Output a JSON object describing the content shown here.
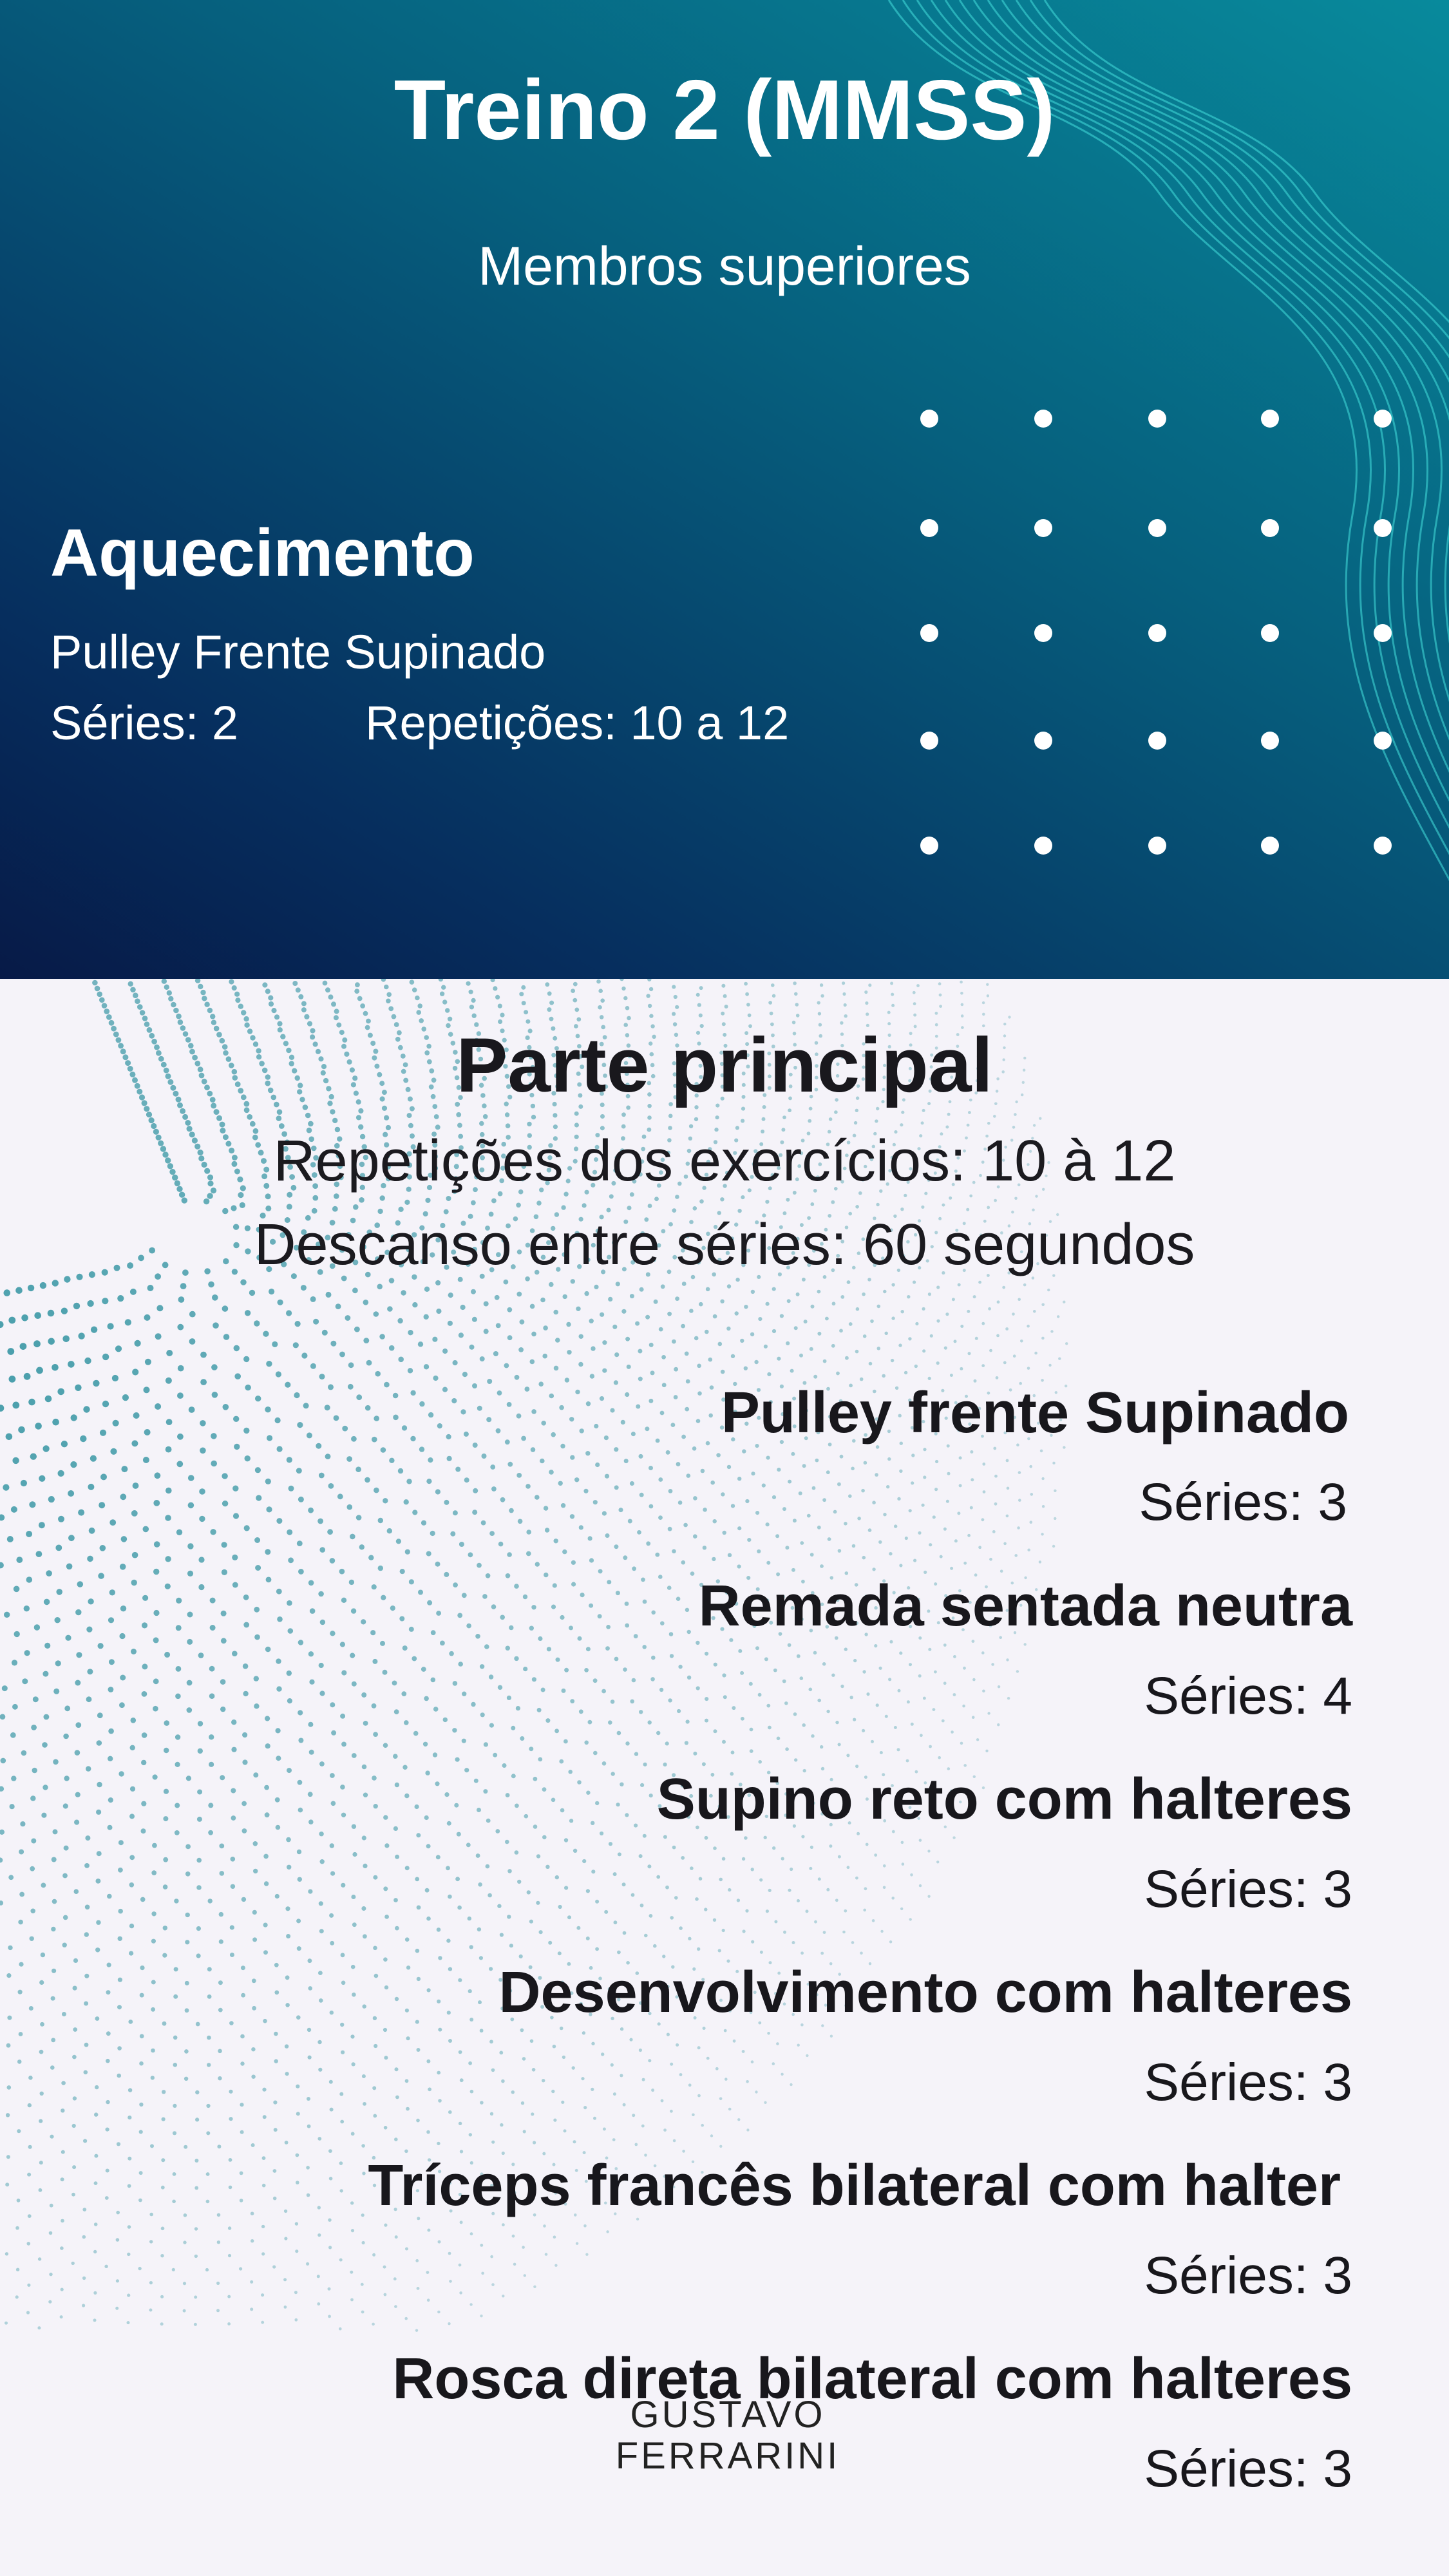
{
  "header": {
    "title": "Treino 2 (MMSS)",
    "subtitle": "Membros superiores"
  },
  "warmup": {
    "heading": "Aquecimento",
    "exercise": "Pulley Frente Supinado",
    "series": "Séries: 2",
    "reps": "Repetições: 10 a 12"
  },
  "main": {
    "heading": "Parte principal",
    "reps_info": "Repetições dos exercícios: 10 à 12",
    "rest_info": "Descanso entre séries: 60 segundos",
    "exercises": [
      {
        "name": "Pulley frente Supinado",
        "series": "Séries: 3"
      },
      {
        "name": "Remada sentada neutra",
        "series": "Séries: 4"
      },
      {
        "name": "Supino reto com halteres",
        "series": "Séries: 3"
      },
      {
        "name": "Desenvolvimento com halteres",
        "series": "Séries: 3"
      },
      {
        "name": "Tríceps francês bilateral com halter",
        "series": "Séries: 3"
      },
      {
        "name": "Rosca direta bilateral com halteres",
        "series": "Séries: 3"
      }
    ]
  },
  "brand": {
    "line1": "GUSTAVO",
    "line2": "FERRARINI"
  },
  "colors": {
    "header_dark": "#071a47",
    "header_light": "#088a9c",
    "background": "#f5f3f9",
    "accent_dots": "#2a8f9e"
  }
}
